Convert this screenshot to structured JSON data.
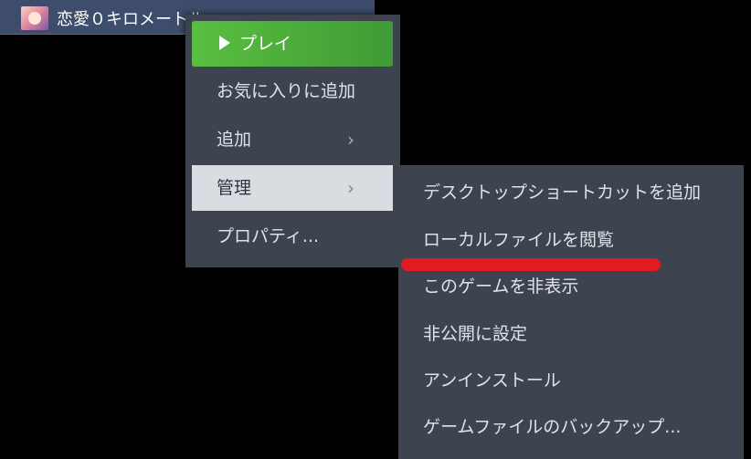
{
  "game": {
    "title": "恋愛０キロメートル"
  },
  "context_menu": {
    "play_label": "プレイ",
    "add_to_favorites_label": "お気に入りに追加",
    "add_label": "追加",
    "manage_label": "管理",
    "properties_label": "プロパティ...",
    "chevron": "›"
  },
  "manage_submenu": {
    "items": [
      "デスクトップショートカットを追加",
      "ローカルファイルを閲覧",
      "このゲームを非表示",
      "非公開に設定",
      "アンインストール",
      "ゲームファイルのバックアップ..."
    ]
  },
  "colors": {
    "menu_bg": "#3d4450",
    "play_green": "#4caf3c",
    "highlight_red": "#e21a22",
    "active_item_bg": "#d9dde1"
  }
}
